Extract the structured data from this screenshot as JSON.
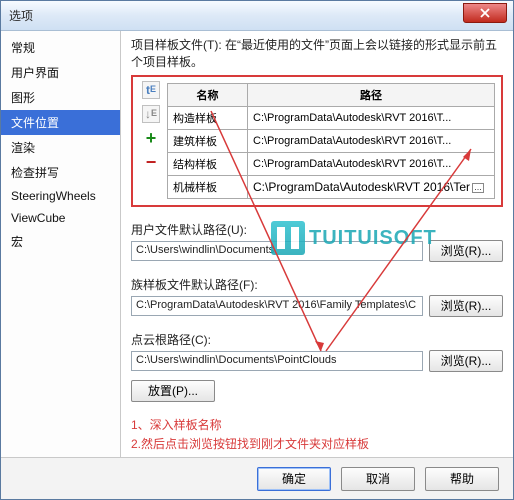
{
  "window": {
    "title": "选项"
  },
  "sidebar": {
    "items": [
      {
        "label": "常规"
      },
      {
        "label": "用户界面"
      },
      {
        "label": "图形"
      },
      {
        "label": "文件位置",
        "selected": true
      },
      {
        "label": "渲染"
      },
      {
        "label": "检查拼写"
      },
      {
        "label": "SteeringWheels"
      },
      {
        "label": "ViewCube"
      },
      {
        "label": "宏"
      }
    ]
  },
  "content": {
    "hint": "项目样板文件(T): 在“最近使用的文件”页面上会以链接的形式显示前五个项目样板。",
    "table": {
      "headers": {
        "name": "名称",
        "path": "路径"
      },
      "rows": [
        {
          "name": "构造样板",
          "path": "C:\\ProgramData\\Autodesk\\RVT 2016\\T..."
        },
        {
          "name": "建筑样板",
          "path": "C:\\ProgramData\\Autodesk\\RVT 2016\\T..."
        },
        {
          "name": "结构样板",
          "path": "C:\\ProgramData\\Autodesk\\RVT 2016\\T..."
        },
        {
          "name": "机械样板",
          "path": "C:\\ProgramData\\Autodesk\\RVT 2016\\Ter"
        }
      ]
    },
    "user_path_label": "用户文件默认路径(U):",
    "user_path_value": "C:\\Users\\windlin\\Documents",
    "family_path_label": "族样板文件默认路径(F):",
    "family_path_value": "C:\\ProgramData\\Autodesk\\RVT 2016\\Family Templates\\C",
    "cloud_path_label": "点云根路径(C):",
    "cloud_path_value": "C:\\Users\\windlin\\Documents\\PointClouds",
    "browse_label": "浏览(R)...",
    "place_label": "放置(P)...",
    "annotation_line1": "1、深入样板名称",
    "annotation_line2": "2.然后点击浏览按钮找到刚才文件夹对应样板"
  },
  "watermark": {
    "text": "TUITUISOFT"
  },
  "footer": {
    "ok": "确定",
    "cancel": "取消",
    "help": "帮助"
  }
}
